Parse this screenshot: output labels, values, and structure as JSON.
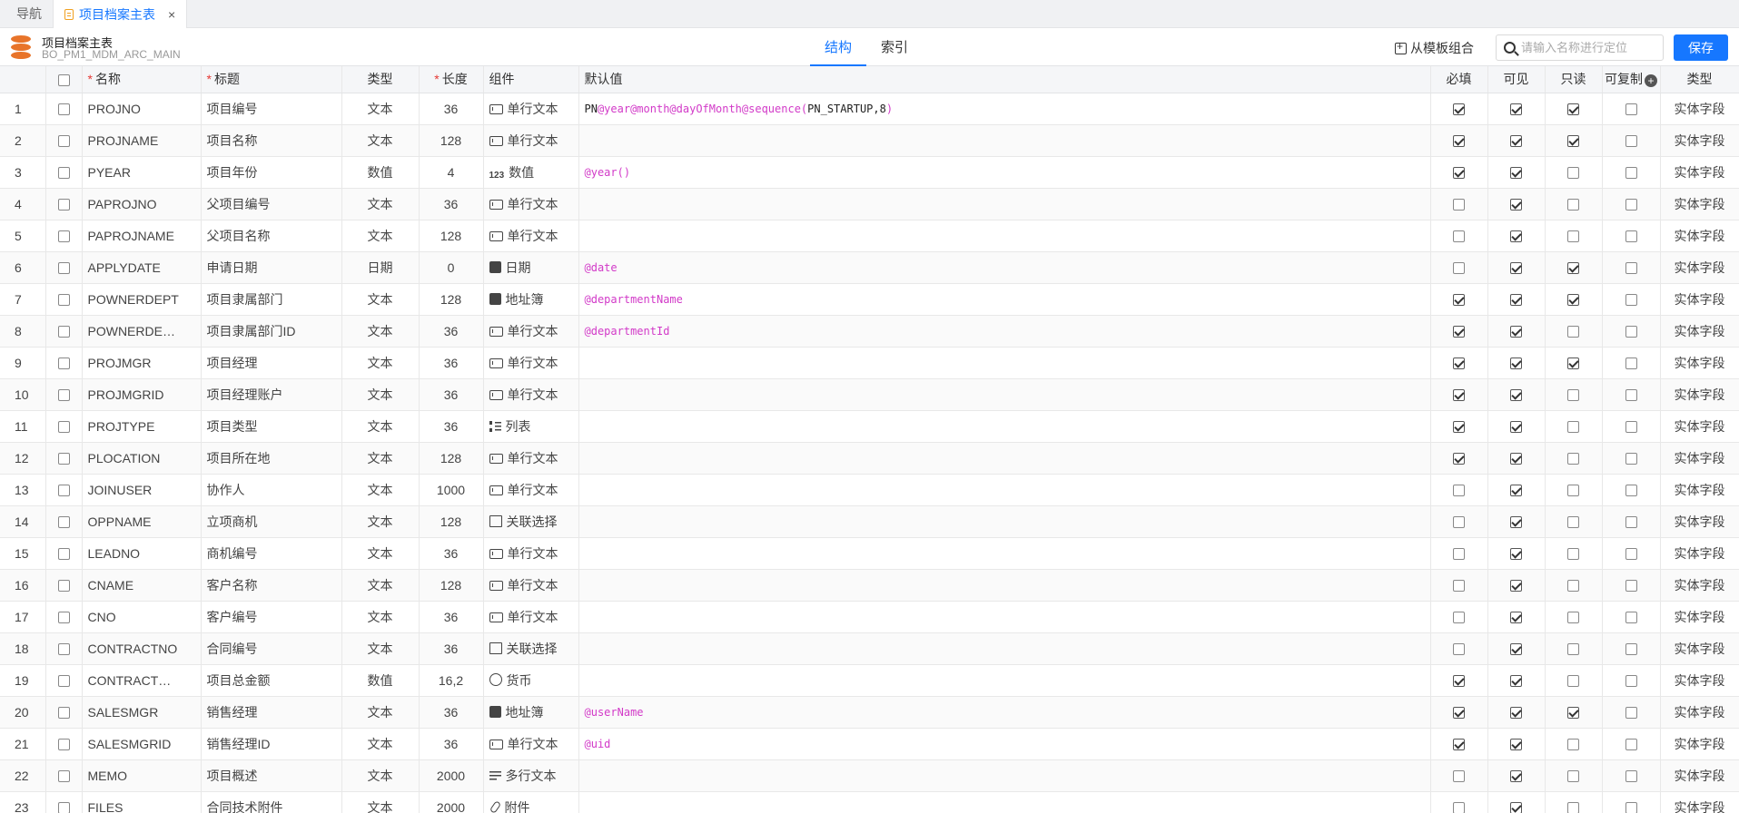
{
  "tabs": [
    {
      "label": "导航",
      "active": false
    },
    {
      "label": "项目档案主表",
      "active": true
    }
  ],
  "header": {
    "title": "项目档案主表",
    "subtitle": "BO_PM1_MDM_ARC_MAIN",
    "subtabs": [
      {
        "label": "结构",
        "active": true
      },
      {
        "label": "索引",
        "active": false
      }
    ],
    "template_button": "从模板组合",
    "search_placeholder": "请输入名称进行定位",
    "save_label": "保存"
  },
  "columns": {
    "name": "名称",
    "title": "标题",
    "type": "类型",
    "length": "长度",
    "component": "组件",
    "default": "默认值",
    "required": "必填",
    "visible": "可见",
    "readonly": "只读",
    "copyable": "可复制",
    "field_type": "类型"
  },
  "rows": [
    {
      "no": "1",
      "name": "PROJNO",
      "title": "项目编号",
      "type": "文本",
      "length": "36",
      "comp_icon": "text-input-icon",
      "component": "单行文本",
      "default": [
        [
          "t",
          "PN"
        ],
        [
          "f",
          "@year@month@dayOfMonth@sequence("
        ],
        [
          "t",
          "PN_STARTUP,8"
        ],
        [
          "f",
          ")"
        ]
      ],
      "required": true,
      "visible": true,
      "readonly": true,
      "copyable": false,
      "field_type": "实体字段"
    },
    {
      "no": "2",
      "name": "PROJNAME",
      "title": "项目名称",
      "type": "文本",
      "length": "128",
      "comp_icon": "text-input-icon",
      "component": "单行文本",
      "default": [],
      "required": true,
      "visible": true,
      "readonly": true,
      "copyable": false,
      "field_type": "实体字段"
    },
    {
      "no": "3",
      "name": "PYEAR",
      "title": "项目年份",
      "type": "数值",
      "length": "4",
      "comp_icon": "number-icon",
      "component": "数值",
      "default": [
        [
          "f",
          "@year()"
        ]
      ],
      "required": true,
      "visible": true,
      "readonly": false,
      "copyable": false,
      "field_type": "实体字段"
    },
    {
      "no": "4",
      "name": "PAPROJNO",
      "title": "父项目编号",
      "type": "文本",
      "length": "36",
      "comp_icon": "text-input-icon",
      "component": "单行文本",
      "default": [],
      "required": false,
      "visible": true,
      "readonly": false,
      "copyable": false,
      "field_type": "实体字段"
    },
    {
      "no": "5",
      "name": "PAPROJNAME",
      "title": "父项目名称",
      "type": "文本",
      "length": "128",
      "comp_icon": "text-input-icon",
      "component": "单行文本",
      "default": [],
      "required": false,
      "visible": true,
      "readonly": false,
      "copyable": false,
      "field_type": "实体字段"
    },
    {
      "no": "6",
      "name": "APPLYDATE",
      "title": "申请日期",
      "type": "日期",
      "length": "0",
      "comp_icon": "calendar-icon",
      "component": "日期",
      "default": [
        [
          "f",
          "@date"
        ]
      ],
      "required": false,
      "visible": true,
      "readonly": true,
      "copyable": false,
      "field_type": "实体字段"
    },
    {
      "no": "7",
      "name": "POWNERDEPT",
      "title": "项目隶属部门",
      "type": "文本",
      "length": "128",
      "comp_icon": "address-book-icon",
      "component": "地址簿",
      "default": [
        [
          "f",
          "@departmentName"
        ]
      ],
      "required": true,
      "visible": true,
      "readonly": true,
      "copyable": false,
      "field_type": "实体字段"
    },
    {
      "no": "8",
      "name": "POWNERDE…",
      "title": "项目隶属部门ID",
      "type": "文本",
      "length": "36",
      "comp_icon": "text-input-icon",
      "component": "单行文本",
      "default": [
        [
          "f",
          "@departmentId"
        ]
      ],
      "required": true,
      "visible": true,
      "readonly": false,
      "copyable": false,
      "field_type": "实体字段"
    },
    {
      "no": "9",
      "name": "PROJMGR",
      "title": "项目经理",
      "type": "文本",
      "length": "36",
      "comp_icon": "text-input-icon",
      "component": "单行文本",
      "default": [],
      "required": true,
      "visible": true,
      "readonly": true,
      "copyable": false,
      "field_type": "实体字段"
    },
    {
      "no": "10",
      "name": "PROJMGRID",
      "title": "项目经理账户",
      "type": "文本",
      "length": "36",
      "comp_icon": "text-input-icon",
      "component": "单行文本",
      "default": [],
      "required": true,
      "visible": true,
      "readonly": false,
      "copyable": false,
      "field_type": "实体字段"
    },
    {
      "no": "11",
      "name": "PROJTYPE",
      "title": "项目类型",
      "type": "文本",
      "length": "36",
      "comp_icon": "list-icon",
      "component": "列表",
      "default": [],
      "required": true,
      "visible": true,
      "readonly": false,
      "copyable": false,
      "field_type": "实体字段"
    },
    {
      "no": "12",
      "name": "PLOCATION",
      "title": "项目所在地",
      "type": "文本",
      "length": "128",
      "comp_icon": "text-input-icon",
      "component": "单行文本",
      "default": [],
      "required": true,
      "visible": true,
      "readonly": false,
      "copyable": false,
      "field_type": "实体字段"
    },
    {
      "no": "13",
      "name": "JOINUSER",
      "title": "协作人",
      "type": "文本",
      "length": "1000",
      "comp_icon": "text-input-icon",
      "component": "单行文本",
      "default": [],
      "required": false,
      "visible": true,
      "readonly": false,
      "copyable": false,
      "field_type": "实体字段"
    },
    {
      "no": "14",
      "name": "OPPNAME",
      "title": "立项商机",
      "type": "文本",
      "length": "128",
      "comp_icon": "relation-icon",
      "component": "关联选择",
      "default": [],
      "required": false,
      "visible": true,
      "readonly": false,
      "copyable": false,
      "field_type": "实体字段"
    },
    {
      "no": "15",
      "name": "LEADNO",
      "title": "商机编号",
      "type": "文本",
      "length": "36",
      "comp_icon": "text-input-icon",
      "component": "单行文本",
      "default": [],
      "required": false,
      "visible": true,
      "readonly": false,
      "copyable": false,
      "field_type": "实体字段"
    },
    {
      "no": "16",
      "name": "CNAME",
      "title": "客户名称",
      "type": "文本",
      "length": "128",
      "comp_icon": "text-input-icon",
      "component": "单行文本",
      "default": [],
      "required": false,
      "visible": true,
      "readonly": false,
      "copyable": false,
      "field_type": "实体字段"
    },
    {
      "no": "17",
      "name": "CNO",
      "title": "客户编号",
      "type": "文本",
      "length": "36",
      "comp_icon": "text-input-icon",
      "component": "单行文本",
      "default": [],
      "required": false,
      "visible": true,
      "readonly": false,
      "copyable": false,
      "field_type": "实体字段"
    },
    {
      "no": "18",
      "name": "CONTRACTNO",
      "title": "合同编号",
      "type": "文本",
      "length": "36",
      "comp_icon": "relation-icon",
      "component": "关联选择",
      "default": [],
      "required": false,
      "visible": true,
      "readonly": false,
      "copyable": false,
      "field_type": "实体字段"
    },
    {
      "no": "19",
      "name": "CONTRACT…",
      "title": "项目总金额",
      "type": "数值",
      "length": "16,2",
      "comp_icon": "currency-icon",
      "component": "货币",
      "default": [],
      "required": true,
      "visible": true,
      "readonly": false,
      "copyable": false,
      "field_type": "实体字段"
    },
    {
      "no": "20",
      "name": "SALESMGR",
      "title": "销售经理",
      "type": "文本",
      "length": "36",
      "comp_icon": "address-book-icon",
      "component": "地址簿",
      "default": [
        [
          "f",
          "@userName"
        ]
      ],
      "required": true,
      "visible": true,
      "readonly": true,
      "copyable": false,
      "field_type": "实体字段"
    },
    {
      "no": "21",
      "name": "SALESMGRID",
      "title": "销售经理ID",
      "type": "文本",
      "length": "36",
      "comp_icon": "text-input-icon",
      "component": "单行文本",
      "default": [
        [
          "f",
          "@uid"
        ]
      ],
      "required": true,
      "visible": true,
      "readonly": false,
      "copyable": false,
      "field_type": "实体字段"
    },
    {
      "no": "22",
      "name": "MEMO",
      "title": "项目概述",
      "type": "文本",
      "length": "2000",
      "comp_icon": "multiline-icon",
      "component": "多行文本",
      "default": [],
      "required": false,
      "visible": true,
      "readonly": false,
      "copyable": false,
      "field_type": "实体字段"
    },
    {
      "no": "23",
      "name": "FILES",
      "title": "合同技术附件",
      "type": "文本",
      "length": "2000",
      "comp_icon": "attachment-icon",
      "component": "附件",
      "default": [],
      "required": false,
      "visible": true,
      "readonly": false,
      "copyable": false,
      "field_type": "实体字段"
    }
  ],
  "colors": {
    "accent": "#1677ff",
    "function_text": "#d23ac8",
    "required_mark": "#e53935",
    "db_icon": "#e8742a"
  }
}
